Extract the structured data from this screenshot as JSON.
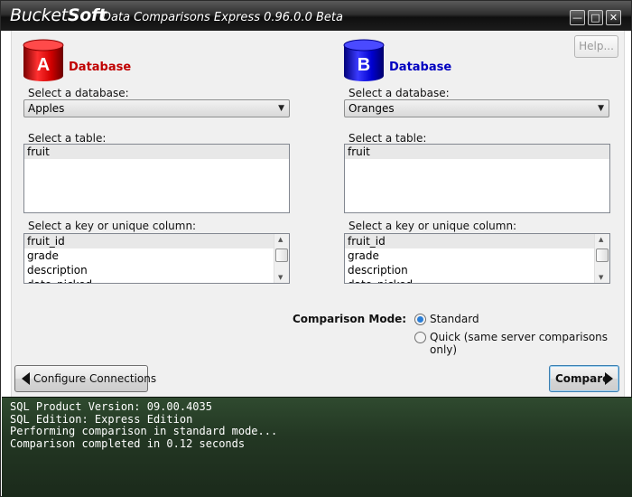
{
  "window": {
    "brand_light": "Bucket",
    "brand_bold": "Soft",
    "title": "Data Comparisons Express 0.96.0.0 Beta",
    "help_label": "Help..."
  },
  "db_a": {
    "letter": "A",
    "title": "Database",
    "color": "#c00000",
    "select_db_label": "Select a database:",
    "selected_db": "Apples",
    "select_table_label": "Select a table:",
    "tables": [
      "fruit"
    ],
    "select_key_label": "Select a key or unique column:",
    "columns": [
      "fruit_id",
      "grade",
      "description",
      "date_picked"
    ]
  },
  "db_b": {
    "letter": "B",
    "title": "Database",
    "color": "#0000c0",
    "select_db_label": "Select a database:",
    "selected_db": "Oranges",
    "select_table_label": "Select a table:",
    "tables": [
      "fruit"
    ],
    "select_key_label": "Select a key or unique column:",
    "columns": [
      "fruit_id",
      "grade",
      "description",
      "date_picked"
    ]
  },
  "mode": {
    "label": "Comparison Mode:",
    "standard": "Standard",
    "quick": "Quick (same server comparisons only)",
    "selected": "standard"
  },
  "buttons": {
    "configure": "Configure Connections",
    "compare": "Compare"
  },
  "console": {
    "lines": [
      "SQL Product Version: 09.00.4035",
      "SQL Edition: Express Edition",
      "Performing comparison in standard mode...",
      "Comparison completed in 0.12 seconds"
    ]
  }
}
